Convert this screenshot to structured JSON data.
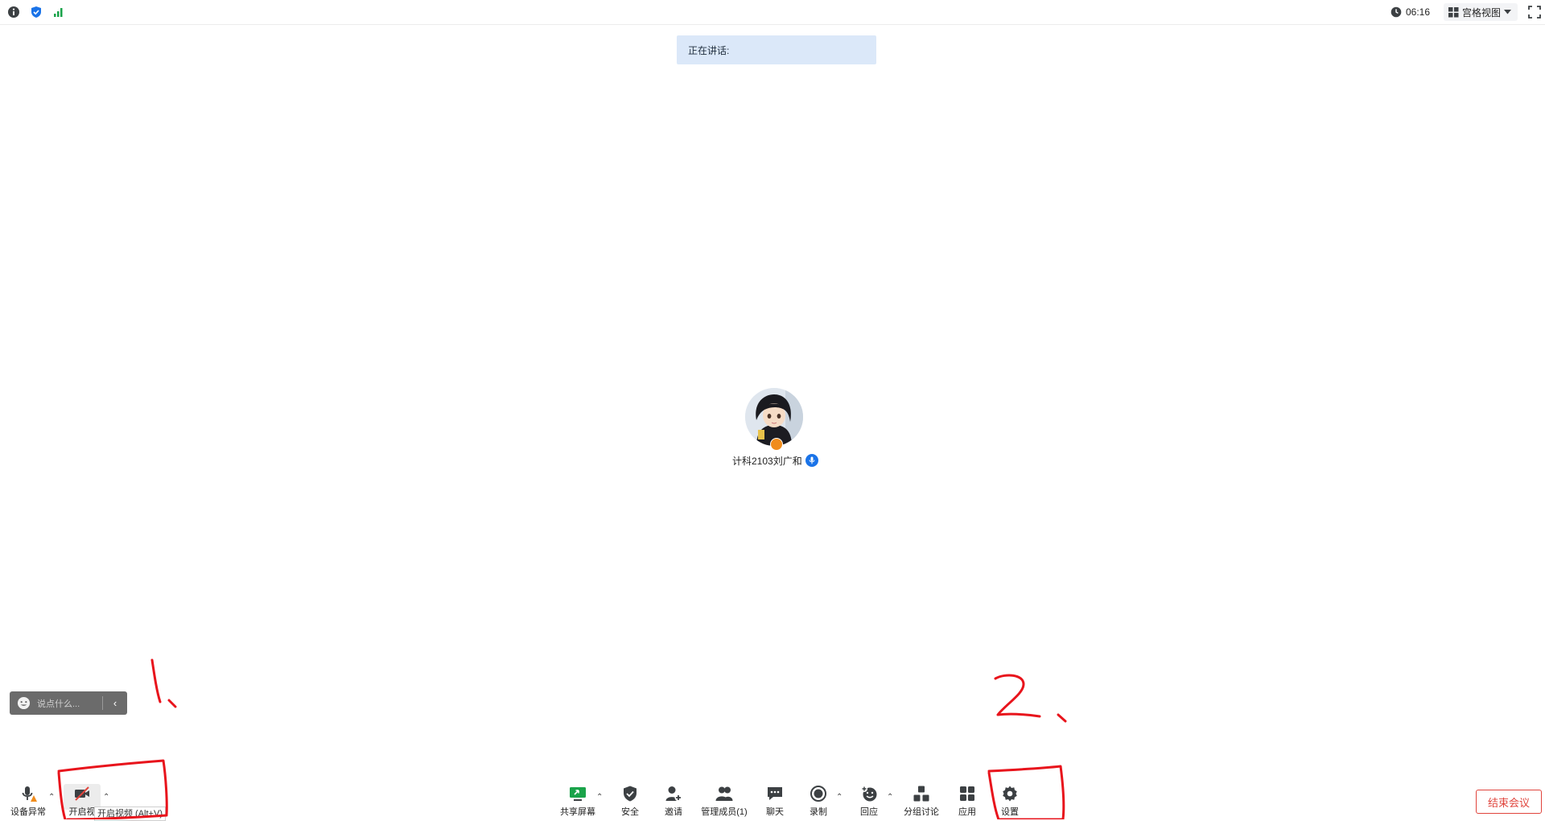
{
  "topbar": {
    "info_icon": "info-icon",
    "shield_icon": "shield-icon",
    "signal_icon": "signal-icon",
    "clock_icon": "clock-icon",
    "time": "06:16",
    "view_label": "宫格视图",
    "fullscreen_icon": "fullscreen-icon",
    "colors": {
      "shield": "#1a73e8",
      "signal": "#1aa34a"
    }
  },
  "banner": {
    "speaking_label": "正在讲话:"
  },
  "participant": {
    "name": "计科2103刘广和"
  },
  "chat": {
    "placeholder": "说点什么..."
  },
  "toolbar": {
    "left": [
      {
        "label": "设备异常",
        "icon": "mic-warning-icon"
      },
      {
        "label": "开启视",
        "icon": "camera-off-icon"
      }
    ],
    "tooltip": "开启视频 (Alt+V)",
    "center": [
      {
        "label": "共享屏幕",
        "icon": "share-screen-icon"
      },
      {
        "label": "安全",
        "icon": "shield-icon"
      },
      {
        "label": "邀请",
        "icon": "invite-icon"
      },
      {
        "label": "管理成员(1)",
        "icon": "members-icon"
      },
      {
        "label": "聊天",
        "icon": "chat-icon"
      },
      {
        "label": "录制",
        "icon": "record-icon"
      },
      {
        "label": "回应",
        "icon": "reaction-icon"
      },
      {
        "label": "分组讨论",
        "icon": "breakout-icon"
      },
      {
        "label": "应用",
        "icon": "apps-icon"
      },
      {
        "label": "设置",
        "icon": "gear-icon"
      }
    ],
    "end_meeting": "结束会议",
    "colors": {
      "end": "#e0443c",
      "share": "#1aa34a"
    }
  },
  "annotations": {
    "mark1": "1.",
    "mark2": "2.",
    "color": "#e8141c"
  }
}
